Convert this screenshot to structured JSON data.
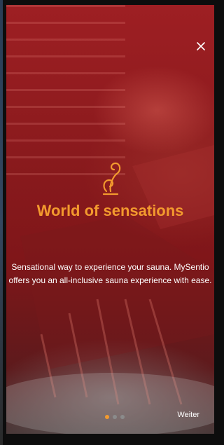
{
  "onboarding": {
    "title": "World of sensations",
    "description": "Sensational way to experience your sauna. MySentio offers you an all-inclusive sauna experience with ease.",
    "next_label": "Weiter",
    "pagination": {
      "total": 3,
      "current": 1
    },
    "close_icon": "close-icon",
    "logo_icon": "sentio-swirl-icon"
  },
  "colors": {
    "accent": "#f39a2e",
    "background_tint": "#9e1f23"
  }
}
